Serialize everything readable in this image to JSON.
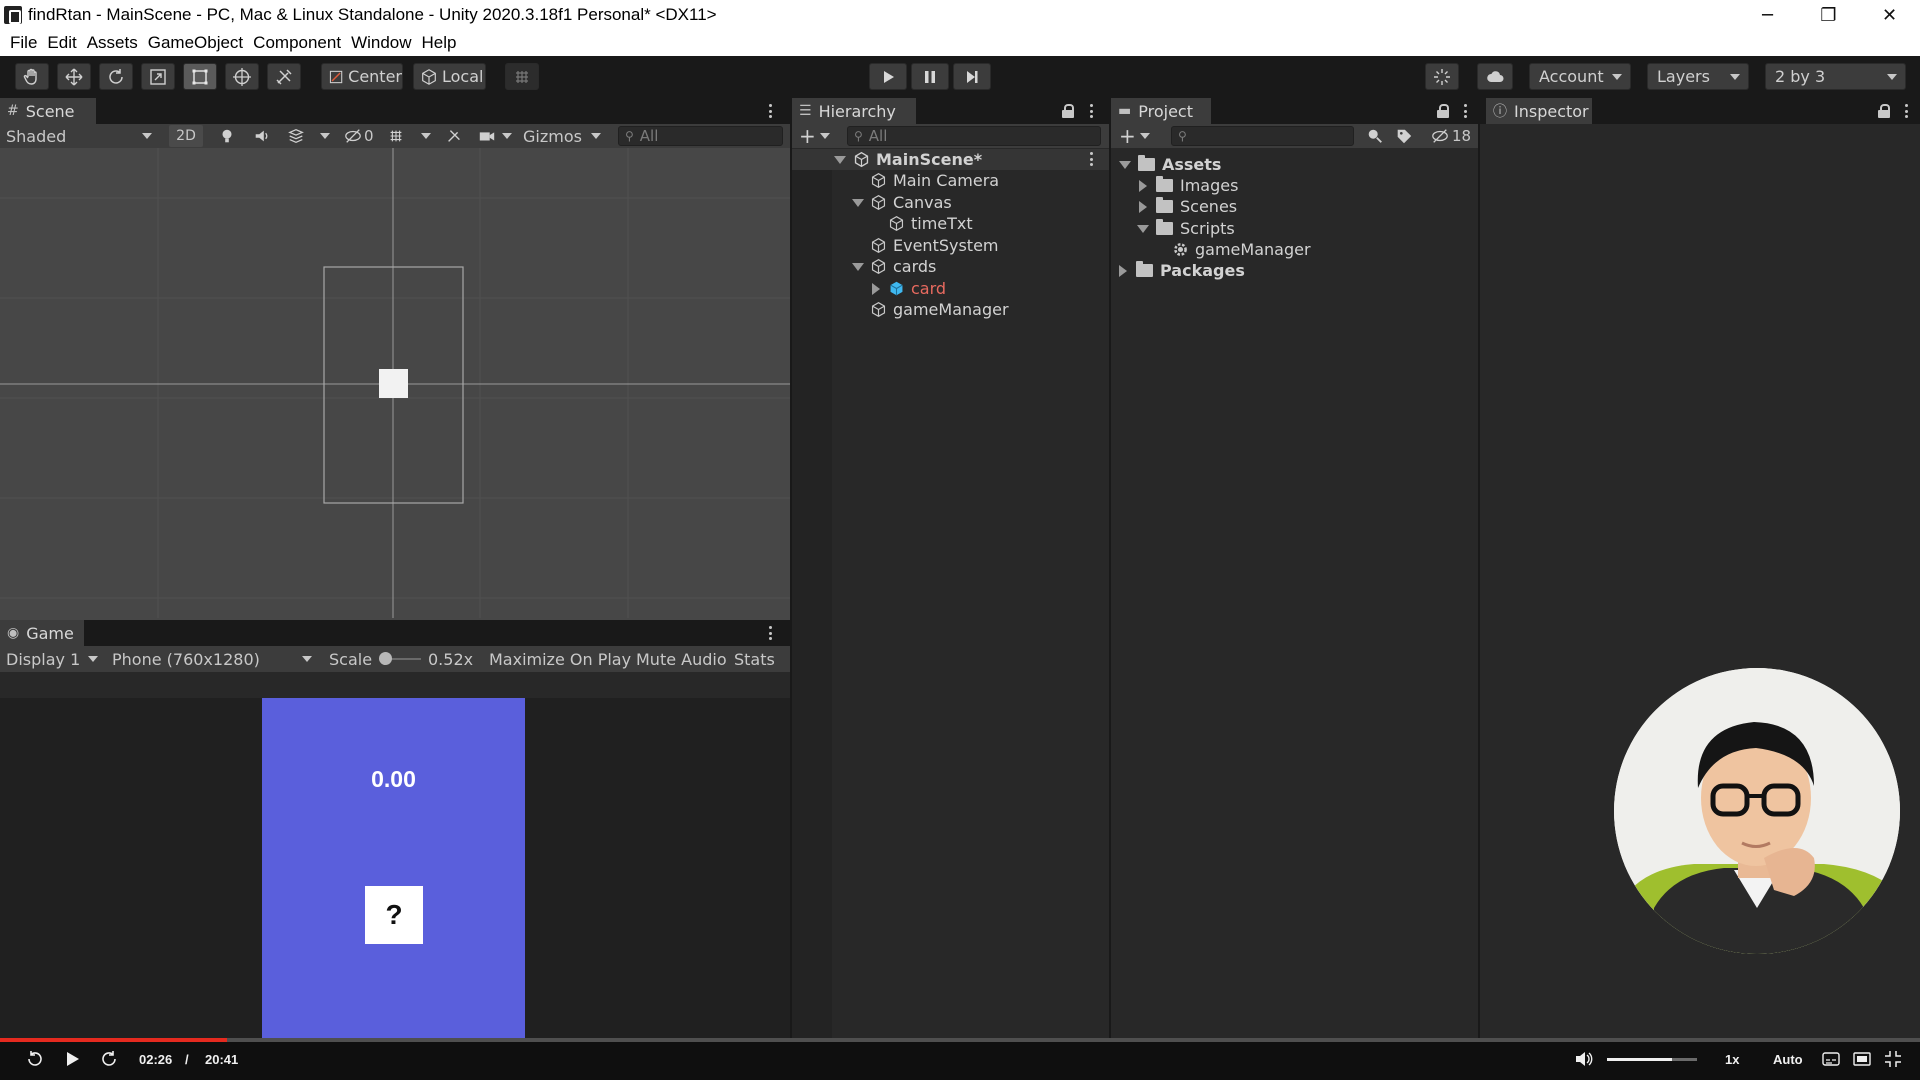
{
  "window": {
    "title": "findRtan - MainScene - PC, Mac & Linux Standalone - Unity 2020.3.18f1 Personal* <DX11>",
    "minimize_glyph": "─",
    "restore_glyph": "❐",
    "close_glyph": "✕"
  },
  "menubar": [
    "File",
    "Edit",
    "Assets",
    "GameObject",
    "Component",
    "Window",
    "Help"
  ],
  "toolbar": {
    "pivot_label": "Center",
    "space_label": "Local",
    "account_label": "Account",
    "layers_label": "Layers",
    "layout_label": "2 by 3"
  },
  "scene": {
    "tab_label": "Scene",
    "shading_mode": "Shaded",
    "mode_2d_label": "2D",
    "hidden_count": "0",
    "gizmos_label": "Gizmos",
    "search_placeholder": "All"
  },
  "game": {
    "tab_label": "Game",
    "display_label": "Display 1",
    "resolution_label": "Phone (760x1280)",
    "scale_label": "Scale",
    "scale_value": "0.52x",
    "maximize_label": "Maximize On Play",
    "mute_label": "Mute Audio",
    "stats_label": "Stats",
    "timer_text": "0.00",
    "card_text": "?",
    "background_color": "#5a5fdc"
  },
  "hierarchy": {
    "tab_label": "Hierarchy",
    "search_placeholder": "All",
    "scene_name": "MainScene*",
    "items": {
      "main_camera": "Main Camera",
      "canvas": "Canvas",
      "time_txt": "timeTxt",
      "event_system": "EventSystem",
      "cards": "cards",
      "card": "card",
      "game_manager": "gameManager"
    },
    "prefab_missing_color": "#e86a5f"
  },
  "project": {
    "tab_label": "Project",
    "hidden_count": "18",
    "assets_label": "Assets",
    "images_label": "Images",
    "scenes_label": "Scenes",
    "scripts_label": "Scripts",
    "game_manager_script": "gameManager",
    "packages_label": "Packages"
  },
  "inspector": {
    "tab_label": "Inspector"
  },
  "video": {
    "current_time": "02:26",
    "separator": "/",
    "total_time": "20:41",
    "progress_fraction": 0.118,
    "volume_fraction": 0.72,
    "speed_label": "1x",
    "quality_label": "Auto"
  }
}
